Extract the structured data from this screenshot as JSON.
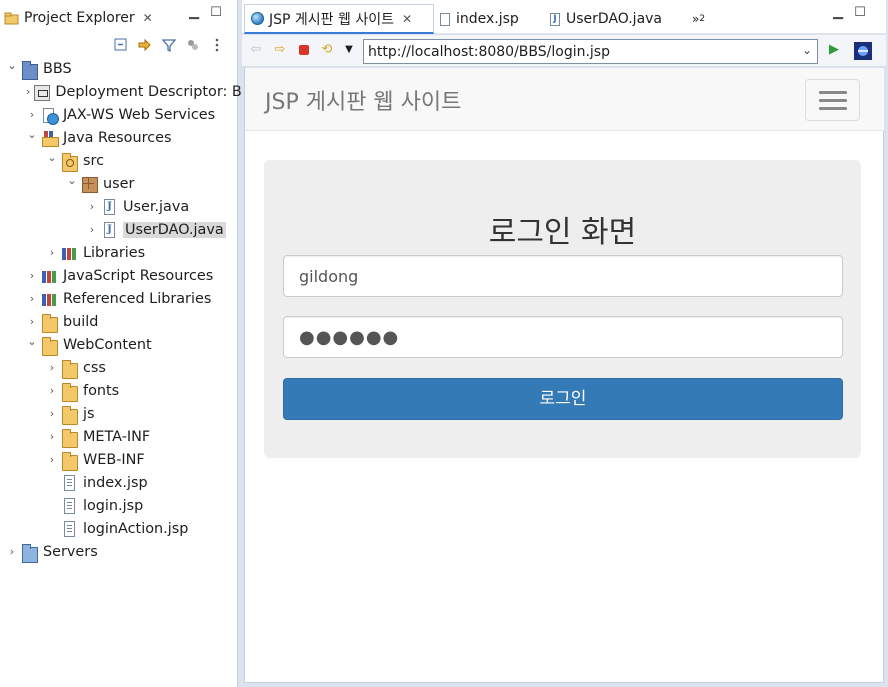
{
  "explorer": {
    "title": "Project Explorer",
    "tree": [
      {
        "label": "BBS",
        "depth": 0,
        "chevron": "expanded",
        "icon": "project-icon"
      },
      {
        "label": "Deployment Descriptor: B",
        "depth": 1,
        "chevron": "collapsed",
        "icon": "deployment-descriptor-icon"
      },
      {
        "label": "JAX-WS Web Services",
        "depth": 1,
        "chevron": "collapsed",
        "icon": "web-services-icon"
      },
      {
        "label": "Java Resources",
        "depth": 1,
        "chevron": "expanded",
        "icon": "java-resources-icon"
      },
      {
        "label": "src",
        "depth": 2,
        "chevron": "expanded",
        "icon": "source-folder-icon"
      },
      {
        "label": "user",
        "depth": 3,
        "chevron": "expanded",
        "icon": "package-icon"
      },
      {
        "label": "User.java",
        "depth": 4,
        "chevron": "collapsed",
        "icon": "java-file-icon"
      },
      {
        "label": "UserDAO.java",
        "depth": 4,
        "chevron": "collapsed",
        "icon": "java-file-icon",
        "selected": true
      },
      {
        "label": "Libraries",
        "depth": 2,
        "chevron": "collapsed",
        "icon": "libraries-icon"
      },
      {
        "label": "JavaScript Resources",
        "depth": 1,
        "chevron": "collapsed",
        "icon": "libraries-icon"
      },
      {
        "label": "Referenced Libraries",
        "depth": 1,
        "chevron": "collapsed",
        "icon": "libraries-icon"
      },
      {
        "label": "build",
        "depth": 1,
        "chevron": "collapsed",
        "icon": "folder-icon"
      },
      {
        "label": "WebContent",
        "depth": 1,
        "chevron": "expanded",
        "icon": "folder-icon"
      },
      {
        "label": "css",
        "depth": 2,
        "chevron": "collapsed",
        "icon": "folder-icon"
      },
      {
        "label": "fonts",
        "depth": 2,
        "chevron": "collapsed",
        "icon": "folder-icon"
      },
      {
        "label": "js",
        "depth": 2,
        "chevron": "collapsed",
        "icon": "folder-icon"
      },
      {
        "label": "META-INF",
        "depth": 2,
        "chevron": "collapsed",
        "icon": "folder-icon"
      },
      {
        "label": "WEB-INF",
        "depth": 2,
        "chevron": "collapsed",
        "icon": "folder-icon"
      },
      {
        "label": "index.jsp",
        "depth": 2,
        "chevron": "none",
        "icon": "jsp-file-icon"
      },
      {
        "label": "login.jsp",
        "depth": 2,
        "chevron": "none",
        "icon": "jsp-file-icon"
      },
      {
        "label": "loginAction.jsp",
        "depth": 2,
        "chevron": "none",
        "icon": "jsp-file-icon"
      },
      {
        "label": "Servers",
        "depth": 0,
        "chevron": "collapsed",
        "icon": "servers-folder-icon"
      }
    ]
  },
  "editor": {
    "tabs": [
      {
        "label": "JSP 게시판 웹 사이트",
        "active": true,
        "icon": "globe-icon"
      },
      {
        "label": "index.jsp",
        "active": false,
        "icon": "jsp-file-icon"
      },
      {
        "label": "UserDAO.java",
        "active": false,
        "icon": "java-file-icon"
      }
    ],
    "overflow_count": "2",
    "url": "http://localhost:8080/BBS/login.jsp"
  },
  "site": {
    "brand": "JSP 게시판 웹 사이트",
    "login": {
      "heading": "로그인 화면",
      "username_value": "gildong",
      "password_value": "●●●●●●",
      "submit_label": "로그인"
    },
    "colors": {
      "primary_button": "#337ab7",
      "jumbotron": "#eeeeee",
      "navbar": "#f8f8f8"
    }
  }
}
